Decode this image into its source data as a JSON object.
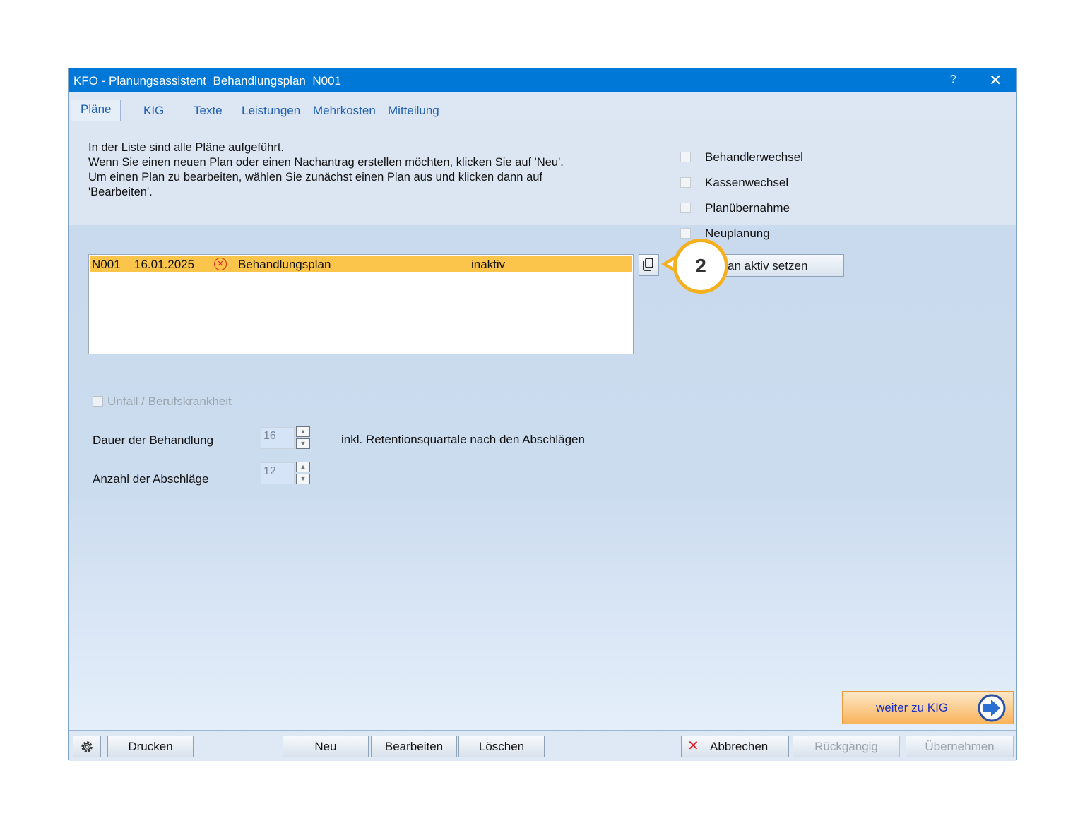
{
  "window": {
    "title": "KFO - Planungsassistent  Behandlungsplan  N001",
    "help_label": "?",
    "close_label": "✕"
  },
  "tabs": [
    {
      "label": "Pläne",
      "active": true
    },
    {
      "label": "KIG"
    },
    {
      "label": "Texte"
    },
    {
      "label": "Leistungen"
    },
    {
      "label": "Mehrkosten"
    },
    {
      "label": "Mitteilung"
    }
  ],
  "intro": {
    "line1": "In der Liste sind alle Pläne aufgeführt.",
    "line2": "Wenn Sie einen neuen Plan oder einen Nachantrag erstellen möchten, klicken Sie auf 'Neu'.",
    "line3": "Um einen Plan zu bearbeiten, wählen Sie zunächst einen Plan aus und klicken dann auf",
    "line4": "'Bearbeiten'."
  },
  "options": [
    {
      "label": "Behandlerwechsel",
      "checked": false
    },
    {
      "label": "Kassenwechsel",
      "checked": false
    },
    {
      "label": "Planübernahme",
      "checked": false
    },
    {
      "label": "Neuplanung",
      "checked": false
    }
  ],
  "plan_list": {
    "rows": [
      {
        "id": "N001",
        "date": "16.01.2025",
        "icon": "error-circle-icon",
        "type": "Behandlungsplan",
        "status": "inaktiv",
        "selected": true
      }
    ]
  },
  "actions": {
    "copy_icon": "copy-icon",
    "set_active_label": "Plan aktiv setzen",
    "set_active_visible": "an aktiv setzen"
  },
  "callout": {
    "number": "2",
    "color": "#f5b01f"
  },
  "unfall": {
    "label": "Unfall / Berufskrankheit",
    "checked": false,
    "disabled": true
  },
  "fields": {
    "dauer_label": "Dauer der Behandlung",
    "dauer_value": "16",
    "anzahl_label": "Anzahl der Abschläge",
    "anzahl_value": "12",
    "inkl_note": "inkl. Retentionsquartale nach den Abschlägen"
  },
  "weiter_button": {
    "label": "weiter zu KIG",
    "icon": "arrow-right-circle-icon"
  },
  "bottom": {
    "settings_icon": "gear-icon",
    "drucken": "Drucken",
    "neu": "Neu",
    "bearbeiten": "Bearbeiten",
    "loeschen": "Löschen",
    "abbrechen": "Abbrechen",
    "rueckgaengig": "Rückgängig",
    "uebernehmen": "Übernehmen"
  },
  "colors": {
    "titlebar": "#0078d7",
    "selection": "#fbc54c",
    "accent_orange": "#f9b45b",
    "cancel_red": "#e0222a"
  }
}
